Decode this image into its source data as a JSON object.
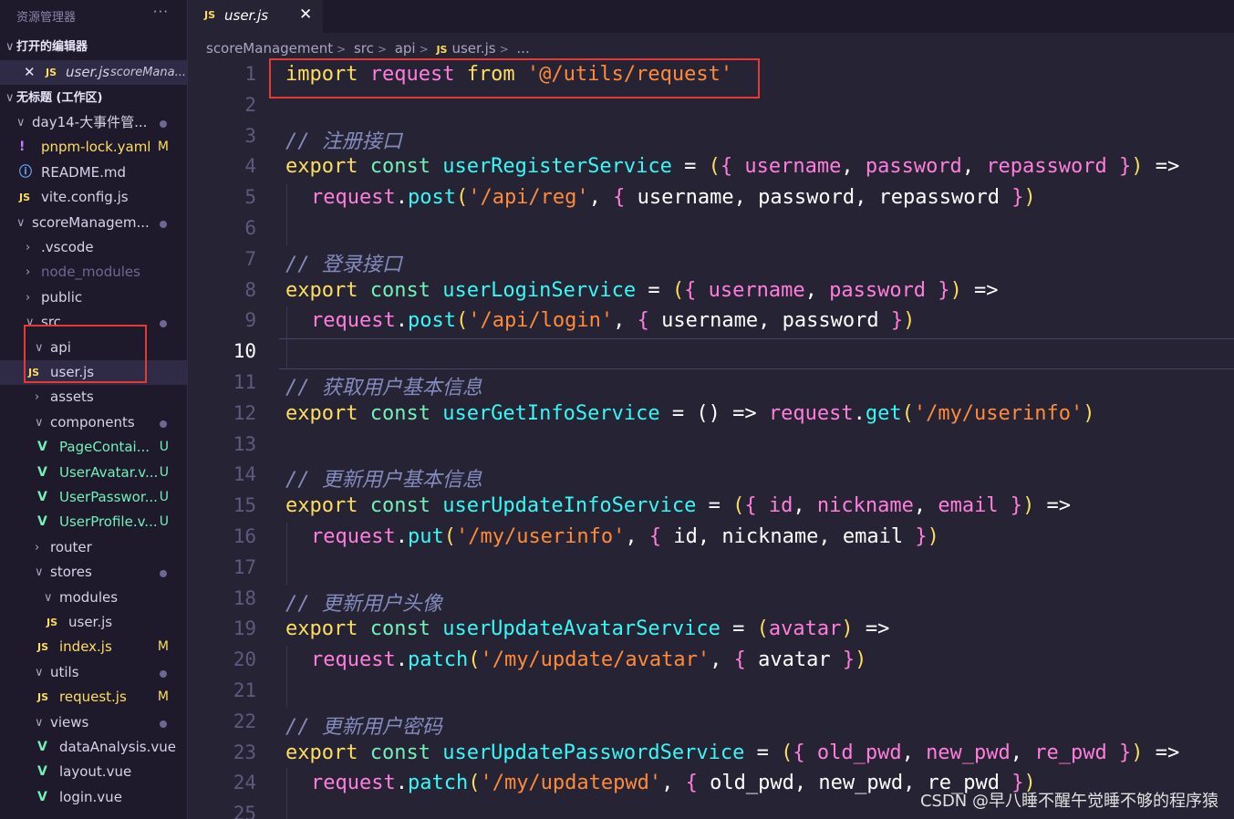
{
  "sidebar": {
    "title": "资源管理器",
    "more": "···",
    "open_editors_header": "打开的编辑器",
    "open_editor": {
      "close": "✕",
      "icon": "JS",
      "name": "user.js",
      "path": "scoreMana..."
    },
    "workspace_header": "无标题 (工作区)",
    "rows": [
      {
        "label": "day14-大事件管...",
        "chev": "∨",
        "dot": true
      },
      {
        "label": "pnpm-lock.yaml",
        "icon": "!",
        "badge": "M"
      },
      {
        "label": "README.md",
        "icon": "ⓘ"
      },
      {
        "label": "vite.config.js",
        "icon": "JS"
      },
      {
        "label": "scoreManagem...",
        "chev": "∨",
        "dot": true
      },
      {
        "label": ".vscode",
        "chev": "›"
      },
      {
        "label": "node_modules",
        "chev": "›"
      },
      {
        "label": "public",
        "chev": "›"
      },
      {
        "label": "src",
        "chev": "∨",
        "dot": true
      },
      {
        "label": "api",
        "chev": "∨"
      },
      {
        "label": "user.js",
        "icon": "JS"
      },
      {
        "label": "assets",
        "chev": "›"
      },
      {
        "label": "components",
        "chev": "∨",
        "dot": true
      },
      {
        "label": "PageContai...",
        "icon": "V",
        "badge": "U"
      },
      {
        "label": "UserAvatar.v...",
        "icon": "V",
        "badge": "U"
      },
      {
        "label": "UserPasswor...",
        "icon": "V",
        "badge": "U"
      },
      {
        "label": "UserProfile.v...",
        "icon": "V",
        "badge": "U"
      },
      {
        "label": "router",
        "chev": "›"
      },
      {
        "label": "stores",
        "chev": "∨",
        "dot": true
      },
      {
        "label": "modules",
        "chev": "∨"
      },
      {
        "label": "user.js",
        "icon": "JS"
      },
      {
        "label": "index.js",
        "icon": "JS",
        "badge": "M"
      },
      {
        "label": "utils",
        "chev": "∨",
        "dot": true
      },
      {
        "label": "request.js",
        "icon": "JS",
        "badge": "M"
      },
      {
        "label": "views",
        "chev": "∨",
        "dot": true
      },
      {
        "label": "dataAnalysis.vue",
        "icon": "V"
      },
      {
        "label": "layout.vue",
        "icon": "V"
      },
      {
        "label": "login.vue",
        "icon": "V"
      }
    ]
  },
  "tab": {
    "icon": "JS",
    "name": "user.js",
    "close": "✕"
  },
  "breadcrumb": {
    "items": [
      "scoreManagement",
      "src",
      "api"
    ],
    "file_icon": "JS",
    "file": "user.js",
    "more": "..."
  },
  "editor": {
    "current_line": 10,
    "lines": [
      [
        [
          "import ",
          "kw"
        ],
        [
          "request ",
          "pm"
        ],
        [
          "from ",
          "kw"
        ],
        [
          "'@/utils/request'",
          "st"
        ]
      ],
      [],
      [
        [
          "// 注册接口",
          "cm"
        ]
      ],
      [
        [
          "export ",
          "kw"
        ],
        [
          "const ",
          "ty"
        ],
        [
          "userRegisterService",
          "fn"
        ],
        [
          " = ",
          "pu"
        ],
        [
          "(",
          "kw"
        ],
        [
          "{ ",
          "br"
        ],
        [
          "username",
          "pm"
        ],
        [
          ", ",
          "pu"
        ],
        [
          "password",
          "pm"
        ],
        [
          ", ",
          "pu"
        ],
        [
          "repassword",
          "pm"
        ],
        [
          " }",
          "br"
        ],
        [
          ")",
          "kw"
        ],
        [
          " =>",
          "pu"
        ]
      ],
      [
        [
          "request",
          "pm"
        ],
        [
          ".",
          "pu"
        ],
        [
          "post",
          "fn"
        ],
        [
          "(",
          "kw"
        ],
        [
          "'/api/reg'",
          "st"
        ],
        [
          ", ",
          "pu"
        ],
        [
          "{ ",
          "br"
        ],
        [
          "username, password, repassword",
          "pu"
        ],
        [
          " }",
          "br"
        ],
        [
          ")",
          "kw"
        ]
      ],
      [],
      [
        [
          "// 登录接口",
          "cm"
        ]
      ],
      [
        [
          "export ",
          "kw"
        ],
        [
          "const ",
          "ty"
        ],
        [
          "userLoginService",
          "fn"
        ],
        [
          " = ",
          "pu"
        ],
        [
          "(",
          "kw"
        ],
        [
          "{ ",
          "br"
        ],
        [
          "username",
          "pm"
        ],
        [
          ", ",
          "pu"
        ],
        [
          "password",
          "pm"
        ],
        [
          " }",
          "br"
        ],
        [
          ")",
          "kw"
        ],
        [
          " =>",
          "pu"
        ]
      ],
      [
        [
          "request",
          "pm"
        ],
        [
          ".",
          "pu"
        ],
        [
          "post",
          "fn"
        ],
        [
          "(",
          "kw"
        ],
        [
          "'/api/login'",
          "st"
        ],
        [
          ", ",
          "pu"
        ],
        [
          "{ ",
          "br"
        ],
        [
          "username, password",
          "pu"
        ],
        [
          " }",
          "br"
        ],
        [
          ")",
          "kw"
        ]
      ],
      [],
      [
        [
          "// 获取用户基本信息",
          "cm"
        ]
      ],
      [
        [
          "export ",
          "kw"
        ],
        [
          "const ",
          "ty"
        ],
        [
          "userGetInfoService",
          "fn"
        ],
        [
          " = ",
          "pu"
        ],
        [
          "() => ",
          "pu"
        ],
        [
          "request",
          "pm"
        ],
        [
          ".",
          "pu"
        ],
        [
          "get",
          "fn"
        ],
        [
          "(",
          "kw"
        ],
        [
          "'/my/userinfo'",
          "st"
        ],
        [
          ")",
          "kw"
        ]
      ],
      [],
      [
        [
          "// 更新用户基本信息",
          "cm"
        ]
      ],
      [
        [
          "export ",
          "kw"
        ],
        [
          "const ",
          "ty"
        ],
        [
          "userUpdateInfoService",
          "fn"
        ],
        [
          " = ",
          "pu"
        ],
        [
          "(",
          "kw"
        ],
        [
          "{ ",
          "br"
        ],
        [
          "id",
          "pm"
        ],
        [
          ", ",
          "pu"
        ],
        [
          "nickname",
          "pm"
        ],
        [
          ", ",
          "pu"
        ],
        [
          "email",
          "pm"
        ],
        [
          " }",
          "br"
        ],
        [
          ")",
          "kw"
        ],
        [
          " =>",
          "pu"
        ]
      ],
      [
        [
          "request",
          "pm"
        ],
        [
          ".",
          "pu"
        ],
        [
          "put",
          "fn"
        ],
        [
          "(",
          "kw"
        ],
        [
          "'/my/userinfo'",
          "st"
        ],
        [
          ", ",
          "pu"
        ],
        [
          "{ ",
          "br"
        ],
        [
          "id, nickname, email",
          "pu"
        ],
        [
          " }",
          "br"
        ],
        [
          ")",
          "kw"
        ]
      ],
      [],
      [
        [
          "// 更新用户头像",
          "cm"
        ]
      ],
      [
        [
          "export ",
          "kw"
        ],
        [
          "const ",
          "ty"
        ],
        [
          "userUpdateAvatarService",
          "fn"
        ],
        [
          " = ",
          "pu"
        ],
        [
          "(",
          "kw"
        ],
        [
          "avatar",
          "pm"
        ],
        [
          ")",
          "kw"
        ],
        [
          " =>",
          "pu"
        ]
      ],
      [
        [
          "request",
          "pm"
        ],
        [
          ".",
          "pu"
        ],
        [
          "patch",
          "fn"
        ],
        [
          "(",
          "kw"
        ],
        [
          "'/my/update/avatar'",
          "st"
        ],
        [
          ", ",
          "pu"
        ],
        [
          "{ ",
          "br"
        ],
        [
          "avatar",
          "pu"
        ],
        [
          " }",
          "br"
        ],
        [
          ")",
          "kw"
        ]
      ],
      [],
      [
        [
          "// 更新用户密码",
          "cm"
        ]
      ],
      [
        [
          "export ",
          "kw"
        ],
        [
          "const ",
          "ty"
        ],
        [
          "userUpdatePasswordService",
          "fn"
        ],
        [
          " = ",
          "pu"
        ],
        [
          "(",
          "kw"
        ],
        [
          "{ ",
          "br"
        ],
        [
          "old_pwd",
          "pm"
        ],
        [
          ", ",
          "pu"
        ],
        [
          "new_pwd",
          "pm"
        ],
        [
          ", ",
          "pu"
        ],
        [
          "re_pwd",
          "pm"
        ],
        [
          " }",
          "br"
        ],
        [
          ")",
          "kw"
        ],
        [
          " =>",
          "pu"
        ]
      ],
      [
        [
          "request",
          "pm"
        ],
        [
          ".",
          "pu"
        ],
        [
          "patch",
          "fn"
        ],
        [
          "(",
          "kw"
        ],
        [
          "'/my/updatepwd'",
          "st"
        ],
        [
          ", ",
          "pu"
        ],
        [
          "{ ",
          "br"
        ],
        [
          "old_pwd, new_pwd, re_pwd",
          "pu"
        ],
        [
          " }",
          "br"
        ],
        [
          ")",
          "kw"
        ]
      ],
      []
    ]
  },
  "watermark": "CSDN @早八睡不醒午觉睡不够的程序猿"
}
